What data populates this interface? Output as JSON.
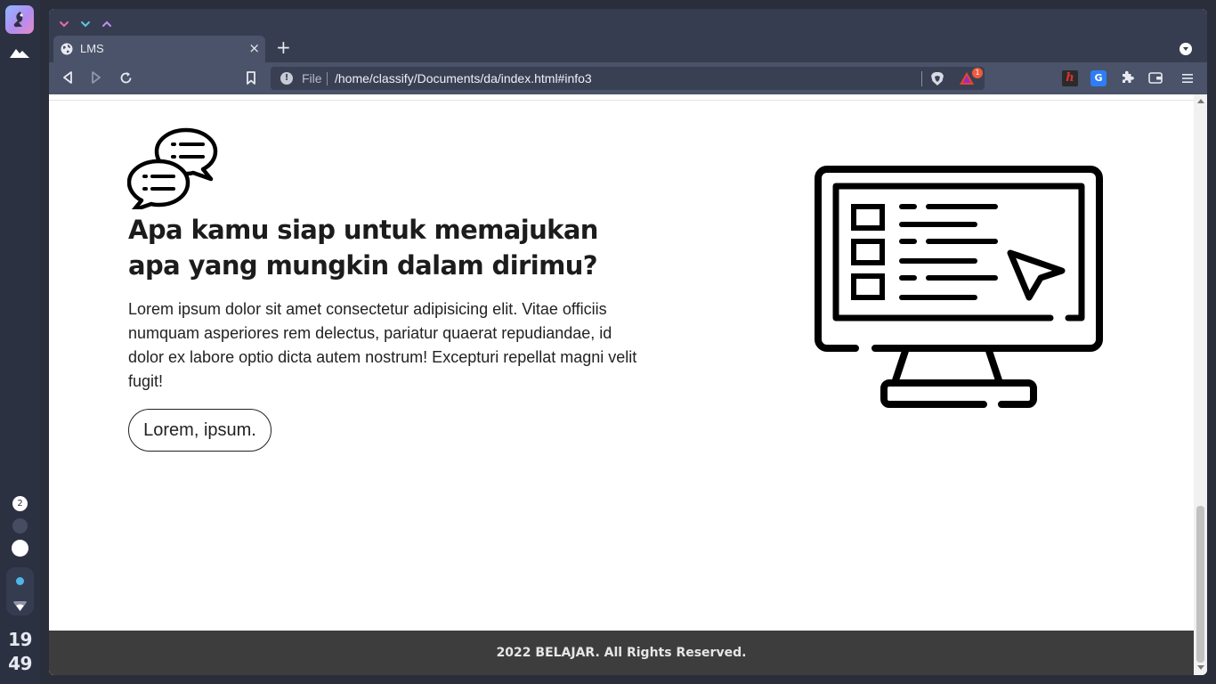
{
  "desktop": {
    "workspace_badge": "2",
    "clock": {
      "hour": "19",
      "minute": "49"
    }
  },
  "browser": {
    "tab": {
      "title": "LMS",
      "close_glyph": "×"
    },
    "new_tab_glyph": "+",
    "address": {
      "scheme_label": "File",
      "path": "/home/classify/Documents/da/index.html#info3"
    },
    "rewards_badge": "1",
    "extensions": {
      "h_label": "h",
      "translate_label": "G"
    }
  },
  "page": {
    "headline": "Apa kamu siap untuk memajukan apa yang mungkin dalam dirimu?",
    "paragraph": "Lorem ipsum dolor sit amet consectetur adipisicing elit. Vitae officiis numquam asperiores rem delectus, pariatur quaerat repudiandae, id dolor ex labore optio dicta autem nostrum! Excepturi repellat magni velit fugit!",
    "button_label": "Lorem, ipsum.",
    "footer_text": "2022 BELAJAR. All Rights Reserved."
  },
  "icons": {
    "dock": [
      "app-launcher-icon",
      "mountain-icon",
      "wifi-icon"
    ],
    "titlebar": [
      "minimize-icon",
      "maximize-icon",
      "restore-icon",
      "globe-icon",
      "tab-list-icon"
    ],
    "toolbar": [
      "back-icon",
      "forward-icon",
      "reload-icon",
      "bookmark-icon",
      "info-icon",
      "brave-shield-icon",
      "rewards-icon",
      "extensions-icon",
      "wallet-icon",
      "menu-icon"
    ],
    "content": [
      "chat-bubbles-icon",
      "monitor-illustration"
    ]
  },
  "colors": {
    "dock_bg": "#2c3142",
    "titlebar_bg": "#373d50",
    "toolbar_bg": "#4a5369",
    "footer_bg": "#3d3d3d",
    "badge_red": "#ef5a3a",
    "accent_blue": "#4db8e8"
  }
}
